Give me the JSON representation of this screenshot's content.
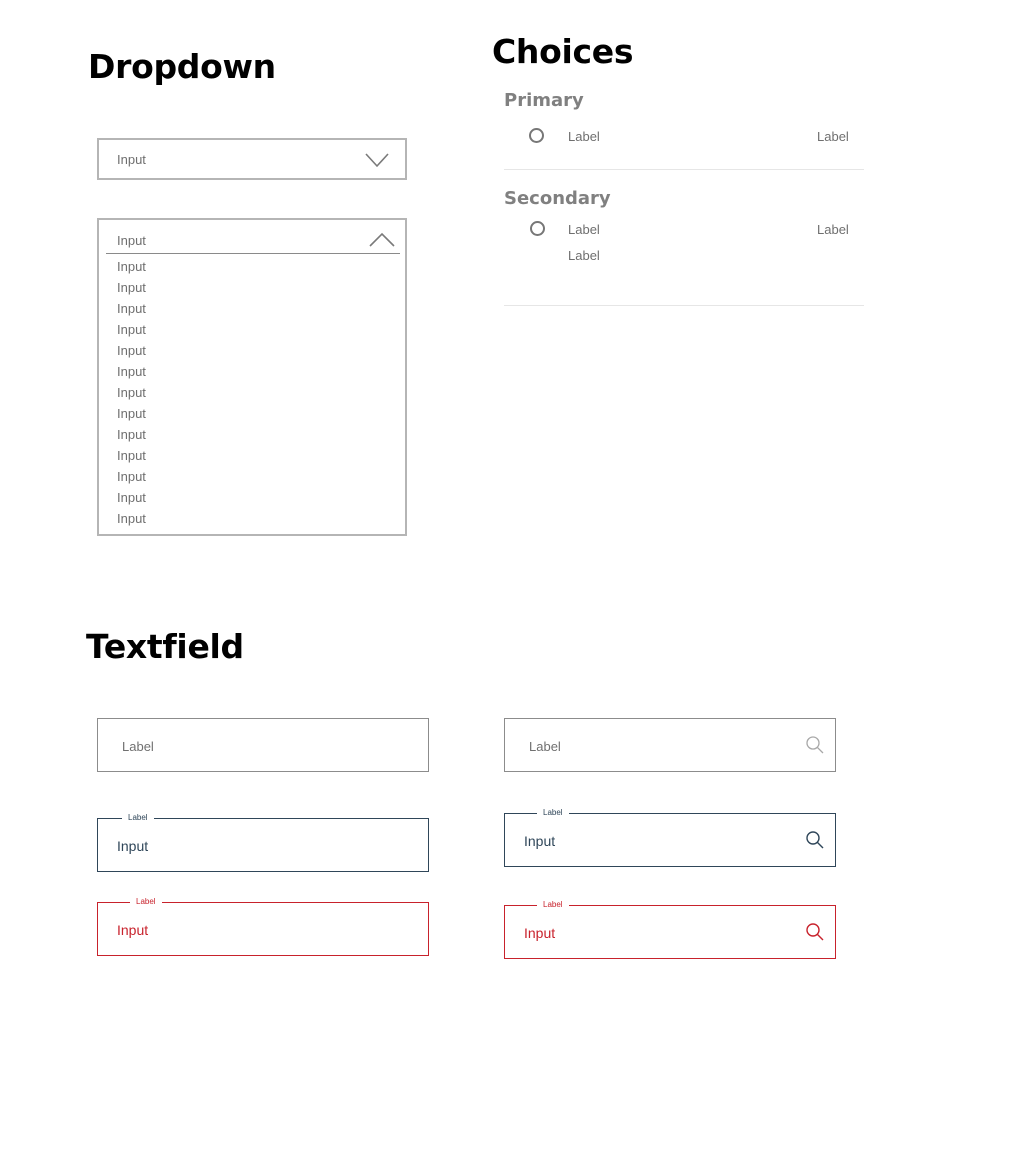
{
  "sections": {
    "dropdown": "Dropdown",
    "choices": "Choices",
    "textfield": "Textfield"
  },
  "dropdown": {
    "closed_value": "Input",
    "open_value": "Input",
    "options": [
      "Input",
      "Input",
      "Input",
      "Input",
      "Input",
      "Input",
      "Input",
      "Input",
      "Input",
      "Input",
      "Input",
      "Input",
      "Input"
    ]
  },
  "choices": {
    "primary": {
      "title": "Primary",
      "label_left": "Label",
      "label_right": "Label"
    },
    "secondary": {
      "title": "Secondary",
      "label_left": "Label",
      "label_right": "Label",
      "label_sub": "Label"
    }
  },
  "textfields": {
    "default_label": "Label",
    "focused": {
      "label": "Label",
      "value": "Input"
    },
    "error": {
      "label": "Label",
      "value": "Input"
    },
    "search_default_label": "Label",
    "search_focused": {
      "label": "Label",
      "value": "Input"
    },
    "search_error": {
      "label": "Label",
      "value": "Input"
    },
    "icon": "search-icon"
  },
  "colors": {
    "focus": "#2f4659",
    "error": "#c8222c",
    "border": "#8c8c8c"
  }
}
